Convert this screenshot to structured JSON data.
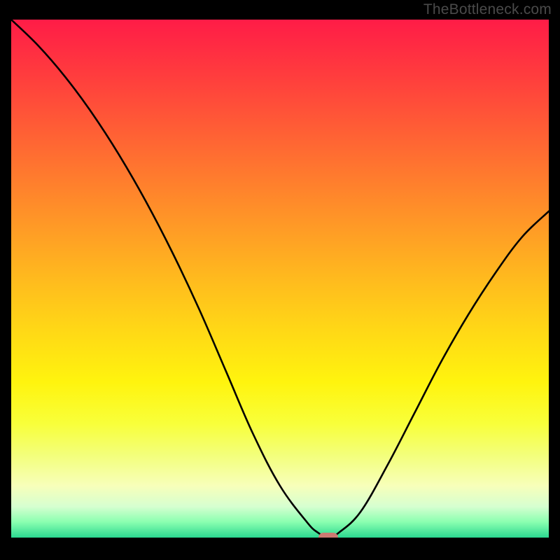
{
  "watermark": "TheBottleneck.com",
  "chart_data": {
    "type": "line",
    "title": "",
    "xlabel": "",
    "ylabel": "",
    "xlim": [
      0,
      100
    ],
    "ylim": [
      0,
      100
    ],
    "grid": false,
    "legend": false,
    "series": [
      {
        "name": "bottleneck-curve",
        "x": [
          0,
          5,
          10,
          15,
          20,
          25,
          30,
          35,
          40,
          45,
          50,
          55,
          57,
          59,
          61,
          65,
          70,
          75,
          80,
          85,
          90,
          95,
          100
        ],
        "y": [
          100,
          95,
          89,
          82,
          74,
          65,
          55,
          44,
          32,
          20,
          10,
          3,
          1,
          0,
          1,
          5,
          14,
          24,
          34,
          43,
          51,
          58,
          63
        ],
        "color": "#000000"
      }
    ],
    "annotations": [
      {
        "name": "optimal-marker",
        "x": 59,
        "y": 0,
        "shape": "rounded-rect",
        "color": "#cc7a72"
      }
    ],
    "background_gradient": {
      "top": "#ff1c47",
      "bottom": "#2bd890",
      "description": "red (high bottleneck) to green (no bottleneck)"
    }
  }
}
